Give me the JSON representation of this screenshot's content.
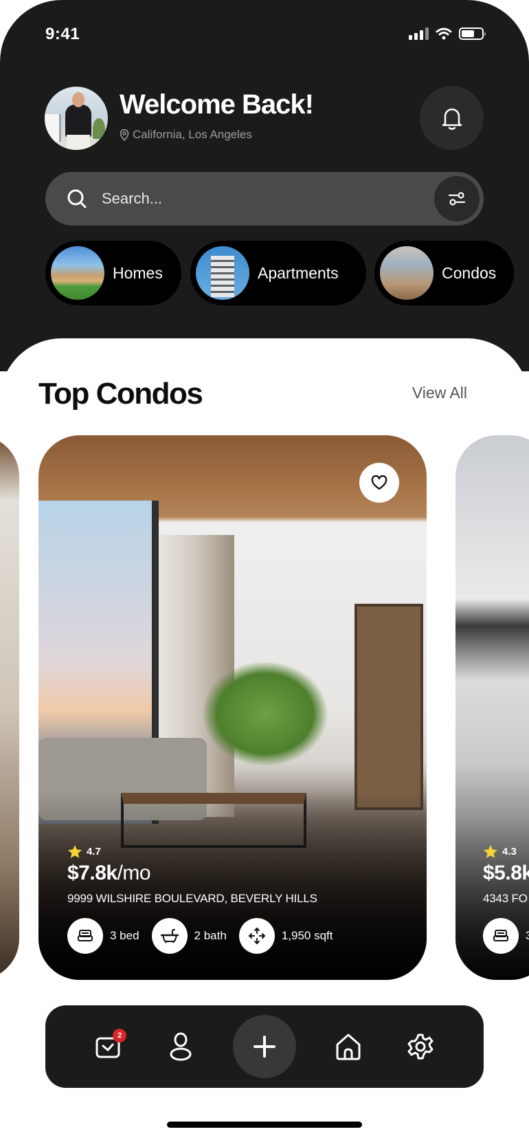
{
  "status_bar": {
    "time": "9:41",
    "icons": [
      "cellular-signal-icon",
      "wifi-icon",
      "battery-icon"
    ]
  },
  "header": {
    "greeting": "Welcome Back!",
    "location": "California, Los Angeles",
    "location_icon": "map-pin-icon",
    "notification_icon": "bell-icon"
  },
  "search": {
    "placeholder": "Search...",
    "value": "",
    "search_icon": "search-icon",
    "filter_icon": "sliders-icon"
  },
  "categories": [
    {
      "label": "Homes",
      "icon": "homes-thumbnail"
    },
    {
      "label": "Apartments",
      "icon": "apartments-thumbnail"
    },
    {
      "label": "Condos",
      "icon": "condos-thumbnail"
    }
  ],
  "section": {
    "title": "Top Condos",
    "view_all": "View All"
  },
  "listings": [
    {
      "rating": "4.7",
      "price": "$7.8k",
      "price_unit": "/mo",
      "address": "9999 WILSHIRE BOULEVARD, BEVERLY HILLS",
      "beds": "3 bed",
      "baths": "2 bath",
      "area": "1,950 sqft",
      "favorite_icon": "heart-icon"
    },
    {
      "rating": "4.3",
      "price": "$5.8k",
      "address": "4343 FO",
      "beds": "3"
    }
  ],
  "bottom_nav": {
    "items": [
      "messages-icon",
      "profile-icon",
      "add-icon",
      "home-icon",
      "settings-icon"
    ],
    "messages_badge": "2"
  },
  "colors": {
    "dark_bg": "#1b1b1b",
    "search_bg": "#4a4a4a",
    "badge_red": "#d8262a",
    "star_yellow": "#f7d433"
  }
}
